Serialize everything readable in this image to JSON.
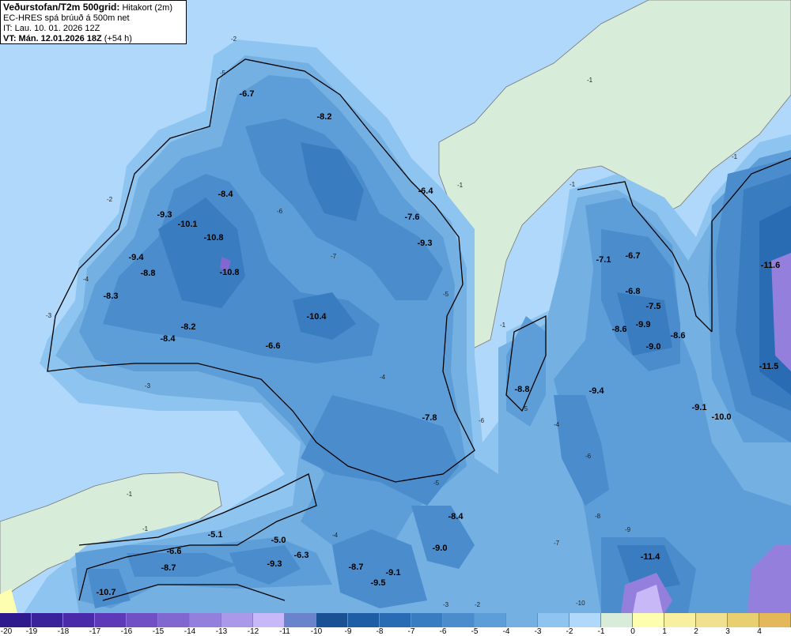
{
  "header": {
    "title_bold": "Veðurstofan/T2m 500grid:",
    "title_rest": "Hitakort (2m)",
    "model": "EC-HRES spá brúuð á 500m net",
    "init_time": "IT: Lau. 10. 01. 2026 12Z",
    "valid_bold": "VT: Mán. 12.01.2026 18Z",
    "valid_rest": "(+54 h)"
  },
  "colors": {
    "sea": "#b0d8fa",
    "greenland_land": "#d8ecda",
    "coastline": "#000000"
  },
  "colorbar": {
    "unit_levels": [
      "-20",
      "-19",
      "-18",
      "-17",
      "-16",
      "-15",
      "-14",
      "-13",
      "-12",
      "-11",
      "-10",
      "-9",
      "-8",
      "-7",
      "-6",
      "-5",
      "-4",
      "-3",
      "-2",
      "-1",
      "0",
      "1",
      "2",
      "3",
      "4"
    ],
    "colors": [
      "#2e1a8c",
      "#3a229a",
      "#4a2aa8",
      "#5e3ab8",
      "#7050c4",
      "#8068d0",
      "#9480dc",
      "#ac98e8",
      "#c8b8f8",
      "#6a84cc",
      "#1a5094",
      "#1e5ea4",
      "#2a6cb4",
      "#3a7cc0",
      "#4a8ccc",
      "#5e9ed8",
      "#74b0e2",
      "#8ec4f0",
      "#b0d8fa",
      "#d8ecda",
      "#fefeb0",
      "#f8f0a0",
      "#f0e090",
      "#e8d070",
      "#e4b858"
    ]
  },
  "point_values": [
    "-6.7",
    "-8.2",
    "-8.4",
    "-9.3",
    "-10.1",
    "-6.4",
    "-7.6",
    "-9.3",
    "-10.8",
    "-9.4",
    "-8.8",
    "-10.8",
    "-8.3",
    "-8.2",
    "-8.4",
    "-10.4",
    "-6.6",
    "-7.1",
    "-6.7",
    "-11.6",
    "-6.8",
    "-7.5",
    "-8.6",
    "-9.9",
    "-9.0",
    "-8.6",
    "-11.5",
    "-8.8",
    "-9.4",
    "-9.1",
    "-10.0",
    "-7.8",
    "-8.4",
    "-9.0",
    "-5.1",
    "-5.0",
    "-6.6",
    "-6.3",
    "-9.3",
    "-8.7",
    "-8.7",
    "-9.1",
    "-9.5",
    "-10.7",
    "-11.4"
  ],
  "contour_labels": [
    "-2",
    "-1",
    "-1",
    "-1",
    "-1",
    "-1",
    "-2",
    "-3",
    "-3",
    "-4",
    "-5",
    "-6",
    "-7",
    "-5",
    "-4",
    "-6",
    "-5",
    "-4",
    "-3",
    "-2",
    "-1",
    "-4",
    "-5",
    "-6",
    "-8",
    "-9",
    "-7",
    "-1",
    "-10"
  ]
}
